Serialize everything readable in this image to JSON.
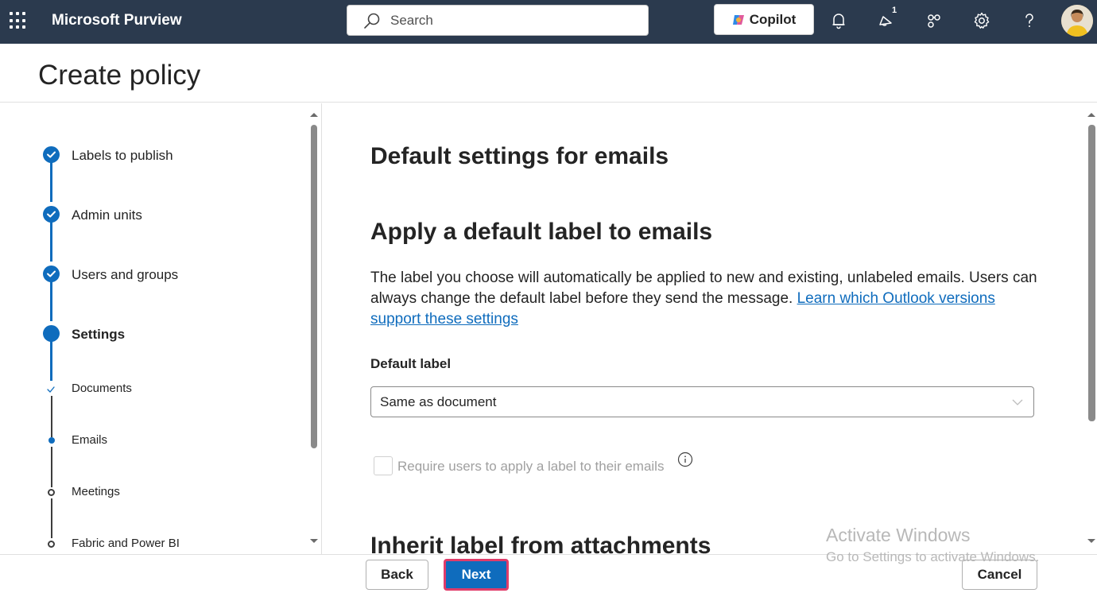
{
  "topbar": {
    "app_title": "Microsoft Purview",
    "search_placeholder": "Search",
    "copilot_label": "Copilot",
    "notification_badge": "1",
    "bg_color": "#2b3a4e"
  },
  "page": {
    "title": "Create policy"
  },
  "nav": {
    "steps": [
      {
        "label": "Labels to publish",
        "state": "complete"
      },
      {
        "label": "Admin units",
        "state": "complete"
      },
      {
        "label": "Users and groups",
        "state": "complete"
      },
      {
        "label": "Settings",
        "state": "current"
      }
    ],
    "substeps": [
      {
        "label": "Documents",
        "state": "complete"
      },
      {
        "label": "Emails",
        "state": "current"
      },
      {
        "label": "Meetings",
        "state": "pending"
      },
      {
        "label": "Fabric and Power BI",
        "state": "pending"
      }
    ],
    "accent_color": "#0f6cbd"
  },
  "main": {
    "section_title": "Default settings for emails",
    "apply_title": "Apply a default label to emails",
    "description": "The label you choose will automatically be applied to new and existing, unlabeled emails. Users can always change the default label before they send the message.",
    "learn_link": "Learn which Outlook versions support these settings",
    "default_label_heading": "Default label",
    "default_label_value": "Same as document",
    "require_label_text": "Require users to apply a label to their emails",
    "inherit_title": "Inherit label from attachments"
  },
  "footer": {
    "back_label": "Back",
    "next_label": "Next",
    "cancel_label": "Cancel"
  },
  "watermark": {
    "line1": "Activate Windows",
    "line2": "Go to Settings to activate Windows."
  }
}
